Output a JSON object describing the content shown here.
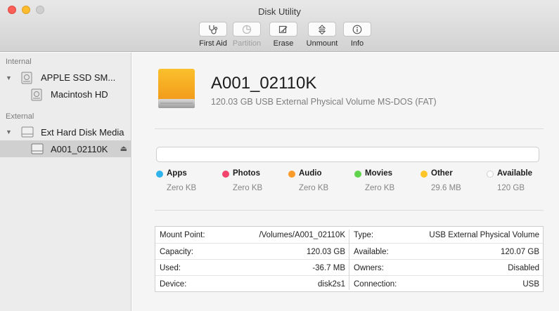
{
  "window": {
    "title": "Disk Utility"
  },
  "toolbar": {
    "first_aid": "First Aid",
    "partition": "Partition",
    "erase": "Erase",
    "unmount": "Unmount",
    "info": "Info"
  },
  "sidebar": {
    "internal_label": "Internal",
    "external_label": "External",
    "items": [
      {
        "label": "APPLE SSD SM...",
        "icon": "internal-disk-icon"
      },
      {
        "label": "Macintosh HD",
        "icon": "internal-volume-icon"
      },
      {
        "label": "Ext Hard Disk Media",
        "icon": "external-disk-icon"
      },
      {
        "label": "A001_02110K",
        "icon": "external-volume-icon",
        "selected": true
      }
    ],
    "eject_glyph": "⏏"
  },
  "volume": {
    "name": "A001_02110K",
    "description": "120.03 GB USB External Physical Volume MS-DOS (FAT)"
  },
  "usage": {
    "items": [
      {
        "name": "Apps",
        "size": "Zero KB",
        "color": "#2fb3ec"
      },
      {
        "name": "Photos",
        "size": "Zero KB",
        "color": "#f2446c"
      },
      {
        "name": "Audio",
        "size": "Zero KB",
        "color": "#f99b29"
      },
      {
        "name": "Movies",
        "size": "Zero KB",
        "color": "#5fd44c"
      },
      {
        "name": "Other",
        "size": "29.6 MB",
        "color": "#ffc62a"
      },
      {
        "name": "Available",
        "size": "120 GB",
        "color": "#ffffff"
      }
    ]
  },
  "info": {
    "left": [
      {
        "label": "Mount Point:",
        "value": "/Volumes/A001_02110K"
      },
      {
        "label": "Capacity:",
        "value": "120.03 GB"
      },
      {
        "label": "Used:",
        "value": "-36.7 MB"
      },
      {
        "label": "Device:",
        "value": "disk2s1"
      }
    ],
    "right": [
      {
        "label": "Type:",
        "value": "USB External Physical Volume"
      },
      {
        "label": "Available:",
        "value": "120.07 GB"
      },
      {
        "label": "Owners:",
        "value": "Disabled"
      },
      {
        "label": "Connection:",
        "value": "USB"
      }
    ]
  }
}
